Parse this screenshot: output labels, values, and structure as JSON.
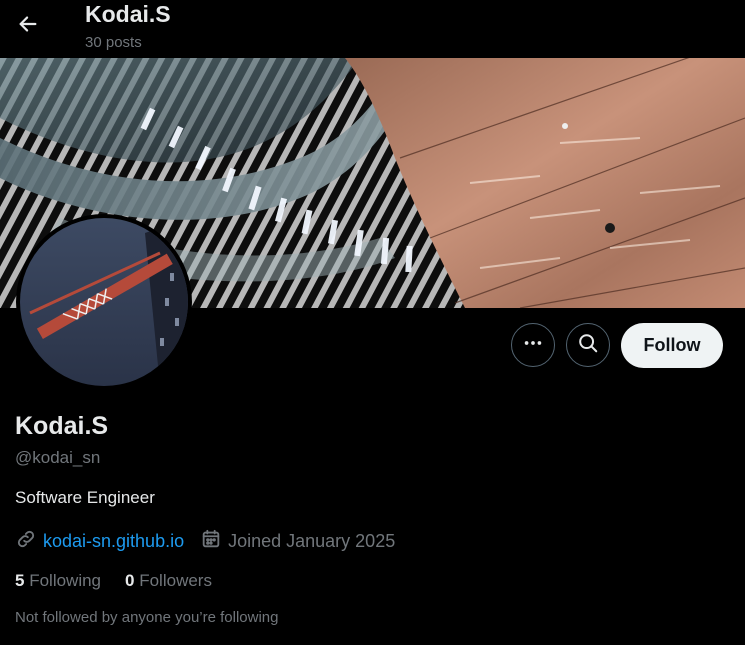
{
  "header": {
    "title": "Kodai.S",
    "post_count": "30 posts",
    "back_icon": "arrow-left-icon"
  },
  "profile": {
    "display_name": "Kodai.S",
    "handle": "@kodai_sn",
    "bio": "Software Engineer",
    "website": "kodai-sn.github.io",
    "joined": "Joined January 2025",
    "following_count": "5",
    "following_label": "Following",
    "followers_count": "0",
    "followers_label": "Followers",
    "not_followed_text": "Not followed by anyone you’re following"
  },
  "actions": {
    "more_icon": "more-horizontal-icon",
    "search_icon": "search-icon",
    "follow_label": "Follow"
  },
  "colors": {
    "background": "#000000",
    "text_primary": "#e7e9ea",
    "text_secondary": "#71767b",
    "link": "#1d9bf0",
    "follow_button_bg": "#eff3f4",
    "follow_button_text": "#0f1419",
    "circle_border": "#536471"
  }
}
